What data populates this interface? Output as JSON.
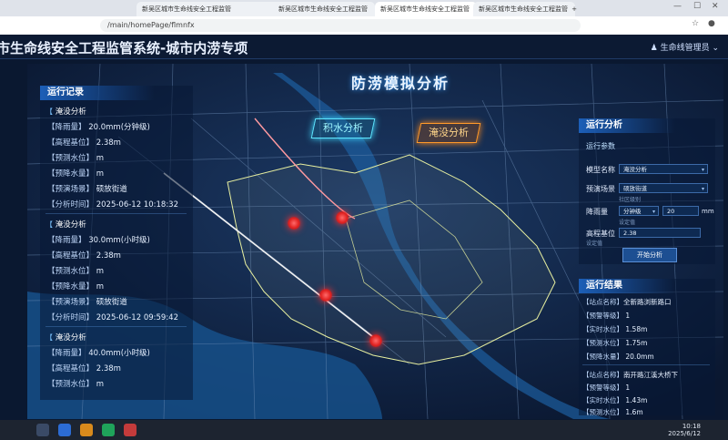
{
  "browser": {
    "tabs": [
      {
        "label": "新吴区城市生命线安全工程监管"
      },
      {
        "label": "新吴区城市生命线安全工程监管"
      },
      {
        "label": "新吴区城市生命线安全工程监管"
      },
      {
        "label": "新吴区城市生命线安全工程监管"
      }
    ],
    "new_tab": "+",
    "url": "/main/homePage/flmnfx"
  },
  "app": {
    "title": "市生命线安全工程监管系统-城市内涝专项",
    "user_label": "生命线管理员",
    "page_heading": "防涝模拟分析",
    "modes": {
      "water": "积水分析",
      "flood": "淹没分析"
    }
  },
  "left_panel": {
    "title": "运行记录",
    "records": [
      {
        "heading": "淹没分析",
        "rows": [
          {
            "k": "【降雨量】",
            "v": "20.0mm(分钟级)"
          },
          {
            "k": "【高程基位】",
            "v": "2.38m"
          },
          {
            "k": "【预测水位】",
            "v": "m"
          },
          {
            "k": "【预降水量】",
            "v": "m"
          },
          {
            "k": "【预演场景】",
            "v": "硕放街道"
          },
          {
            "k": "【分析时间】",
            "v": "2025-06-12 10:18:32"
          }
        ]
      },
      {
        "heading": "淹没分析",
        "rows": [
          {
            "k": "【降雨量】",
            "v": "30.0mm(小时级)"
          },
          {
            "k": "【高程基位】",
            "v": "2.38m"
          },
          {
            "k": "【预测水位】",
            "v": "m"
          },
          {
            "k": "【预降水量】",
            "v": "m"
          },
          {
            "k": "【预演场景】",
            "v": "硕放街道"
          },
          {
            "k": "【分析时间】",
            "v": "2025-06-12 09:59:42"
          }
        ]
      },
      {
        "heading": "淹没分析",
        "rows": [
          {
            "k": "【降雨量】",
            "v": "40.0mm(小时级)"
          },
          {
            "k": "【高程基位】",
            "v": "2.38m"
          },
          {
            "k": "【预测水位】",
            "v": "m"
          }
        ]
      }
    ]
  },
  "right_panel": {
    "title": "运行分析",
    "params_title": "运行参数",
    "fields": {
      "model_label": "模型名称",
      "model_value": "淹没分析",
      "scene_label": "预演场景",
      "scene_value": "硕放街道",
      "scene_sub": "社区级别",
      "rain_label": "降雨量",
      "rain_unit": "分钟级",
      "rain_value": "20",
      "rain_suffix": "mm",
      "rain_sub": "设定值",
      "elev_label": "高程基位",
      "elev_value": "2.38",
      "elev_sub": "设定值"
    },
    "start_button": "开始分析"
  },
  "result_panel": {
    "title": "运行结果",
    "groups": [
      {
        "rows": [
          {
            "k": "【站点名称】",
            "v": "全新路浏新路口"
          },
          {
            "k": "【预警等级】",
            "v": "1"
          },
          {
            "k": "【实时水位】",
            "v": "1.58m"
          },
          {
            "k": "【预测水位】",
            "v": "1.75m"
          },
          {
            "k": "【预降水量】",
            "v": "20.0mm"
          }
        ]
      },
      {
        "rows": [
          {
            "k": "【站点名称】",
            "v": "南开路江溪大桥下"
          },
          {
            "k": "【预警等级】",
            "v": "1"
          },
          {
            "k": "【实时水位】",
            "v": "1.43m"
          },
          {
            "k": "【预测水位】",
            "v": "1.6m"
          }
        ]
      }
    ]
  },
  "taskbar": {
    "time": "10:18",
    "date": "2025/6/12"
  },
  "colors": {
    "panel_title": "#1c5fb8",
    "water_mode": "#5fe6ff",
    "flood_mode": "#ff9a2a",
    "hotspot": "#e0201f"
  }
}
